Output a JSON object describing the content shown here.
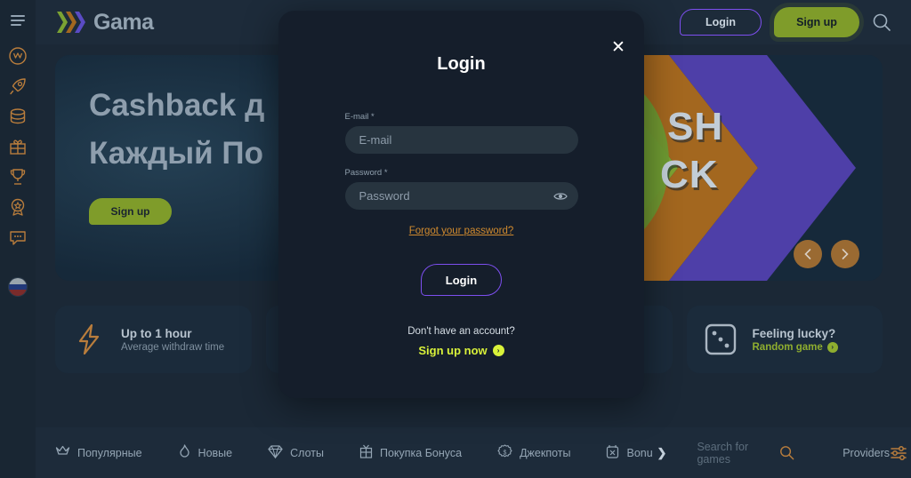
{
  "sidebar": {
    "items": [
      {
        "name": "menu-icon",
        "label": "Menu"
      },
      {
        "name": "vip-crown-icon",
        "label": "VIP"
      },
      {
        "name": "rocket-icon",
        "label": "Rocket"
      },
      {
        "name": "coins-icon",
        "label": "Coins"
      },
      {
        "name": "gift-icon",
        "label": "Gift"
      },
      {
        "name": "trophy-icon",
        "label": "Tournaments"
      },
      {
        "name": "award-badge-icon",
        "label": "Awards"
      },
      {
        "name": "chat-icon",
        "label": "Chat"
      }
    ],
    "language_flag": "ru-flag"
  },
  "header": {
    "logo_text": "Gama",
    "login_label": "Login",
    "signup_label": "Sign up",
    "search_icon": "search-icon",
    "accent_purple": "#7d4ff0",
    "accent_green": "#7f9c2a"
  },
  "hero": {
    "title_line1": "Cashback д",
    "title_line2": "Каждый По",
    "signup_label": "Sign up",
    "banner_word_line1": "SH",
    "banner_word_line2": "CK",
    "prev_arrow": "chevron-left-icon",
    "next_arrow": "chevron-right-icon",
    "stripe_colors": [
      "#7ba233",
      "#a3671f",
      "#4e3fa8"
    ]
  },
  "cards": [
    {
      "icon": "lightning-icon",
      "title": "Up to 1 hour",
      "subtitle": "Average withdraw time",
      "sub_style": "muted"
    },
    {
      "icon": "",
      "title": "",
      "subtitle": "",
      "sub_style": "muted"
    },
    {
      "icon": "",
      "title": "",
      "subtitle": "",
      "sub_style": "muted"
    },
    {
      "icon": "dice-icon",
      "title": "Feeling lucky?",
      "subtitle": "Random game",
      "sub_style": "green"
    }
  ],
  "bottom_nav": {
    "items": [
      {
        "icon": "crown-icon",
        "label": "Популярные"
      },
      {
        "icon": "fire-icon",
        "label": "Новые"
      },
      {
        "icon": "diamond-icon",
        "label": "Слоты"
      },
      {
        "icon": "gift-box-icon",
        "label": "Покупка Бонуса"
      },
      {
        "icon": "jackpot-icon",
        "label": "Джекпоты"
      },
      {
        "icon": "bonus-icon",
        "label": "Bonus"
      }
    ],
    "more_chevron": "chevron-right-icon",
    "search_placeholder": "Search for games",
    "search_icon": "search-icon",
    "providers_label": "Providers",
    "filter_icon": "filter-sliders-icon"
  },
  "modal": {
    "title": "Login",
    "close_icon": "close-icon",
    "email_label": "E-mail *",
    "email_placeholder": "E-mail",
    "email_value": "",
    "password_label": "Password *",
    "password_placeholder": "Password",
    "password_value": "",
    "show_password_icon": "eye-icon",
    "forgot_link": "Forgot your password?",
    "submit_label": "Login",
    "no_account_text": "Don't have an account?",
    "signup_now_label": "Sign up now",
    "signup_now_icon": "arrow-right-circle-icon",
    "border_color": "#7d4ff0",
    "link_color": "#d08a2e",
    "signup_color": "#d9f23a"
  }
}
